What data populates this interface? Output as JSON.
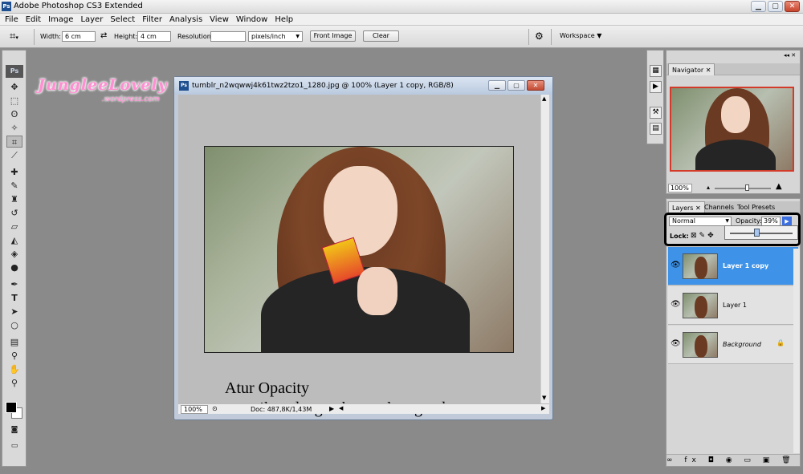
{
  "app": {
    "title": "Adobe Photoshop CS3 Extended",
    "icon_text": "Ps"
  },
  "window_controls": {
    "minimize": "▁",
    "maximize": "▢",
    "close": "✕"
  },
  "menu": [
    "File",
    "Edit",
    "Image",
    "Layer",
    "Select",
    "Filter",
    "Analysis",
    "View",
    "Window",
    "Help"
  ],
  "options_bar": {
    "width_label": "Width:",
    "width_value": "6 cm",
    "swap_icon": "⇄",
    "height_label": "Height:",
    "height_value": "4 cm",
    "resolution_label": "Resolution:",
    "resolution_value": "",
    "resolution_unit": "pixels/inch",
    "front_image_label": "Front Image",
    "clear_label": "Clear",
    "workspace_label": "Workspace ▼"
  },
  "toolbox": {
    "logo": "Ps",
    "tools": [
      {
        "name": "move-tool",
        "glyph": "✥"
      },
      {
        "name": "marquee-tool",
        "glyph": "⬚"
      },
      {
        "name": "lasso-tool",
        "glyph": "ʘ"
      },
      {
        "name": "magic-wand-tool",
        "glyph": "✧"
      },
      {
        "name": "crop-tool",
        "glyph": "⌗"
      },
      {
        "name": "slice-tool",
        "glyph": "⟋"
      },
      {
        "name": "healing-brush-tool",
        "glyph": "✚"
      },
      {
        "name": "brush-tool",
        "glyph": "✎"
      },
      {
        "name": "clone-stamp-tool",
        "glyph": "♜"
      },
      {
        "name": "history-brush-tool",
        "glyph": "↺"
      },
      {
        "name": "eraser-tool",
        "glyph": "▱"
      },
      {
        "name": "paint-bucket-tool",
        "glyph": "◭"
      },
      {
        "name": "blur-tool",
        "glyph": "◈"
      },
      {
        "name": "dodge-tool",
        "glyph": "●"
      },
      {
        "name": "pen-tool",
        "glyph": "✒"
      },
      {
        "name": "type-tool",
        "glyph": "T"
      },
      {
        "name": "path-selection-tool",
        "glyph": "➤"
      },
      {
        "name": "shape-tool",
        "glyph": "○"
      },
      {
        "name": "notes-tool",
        "glyph": "▤"
      },
      {
        "name": "eyedropper-tool",
        "glyph": "⚲"
      },
      {
        "name": "hand-tool",
        "glyph": "✋"
      },
      {
        "name": "zoom-tool",
        "glyph": "⚲"
      }
    ]
  },
  "watermark": {
    "name": "JungleeLovely",
    "sub": ".wordpress.com"
  },
  "document": {
    "title": "tumblr_n2wqwwj4k61twz2tzo1_1280.jpg @ 100% (Layer 1 copy, RGB/8)",
    "icon_text": "Ps",
    "caption_line1": "Atur Opacity",
    "caption_line2": "sesuaikan dengan kecocokan gambar",
    "zoom": "100%",
    "doc_info": "Doc: 487,8K/1,43M"
  },
  "navigator": {
    "tab": "Navigator",
    "zoom": "100%"
  },
  "layers_panel": {
    "tabs": [
      "Layers",
      "Channels",
      "Tool Presets"
    ],
    "blend_mode": "Normal",
    "opacity_label": "Opacity:",
    "opacity_value": "39%",
    "lock_label": "Lock:",
    "layers": [
      {
        "name": "Layer 1 copy",
        "selected": true
      },
      {
        "name": "Layer 1",
        "selected": false
      },
      {
        "name": "Background",
        "selected": false
      }
    ],
    "bottom_icons": "∞ fx ◘ ◉ ▭ ▣ 🗑"
  }
}
